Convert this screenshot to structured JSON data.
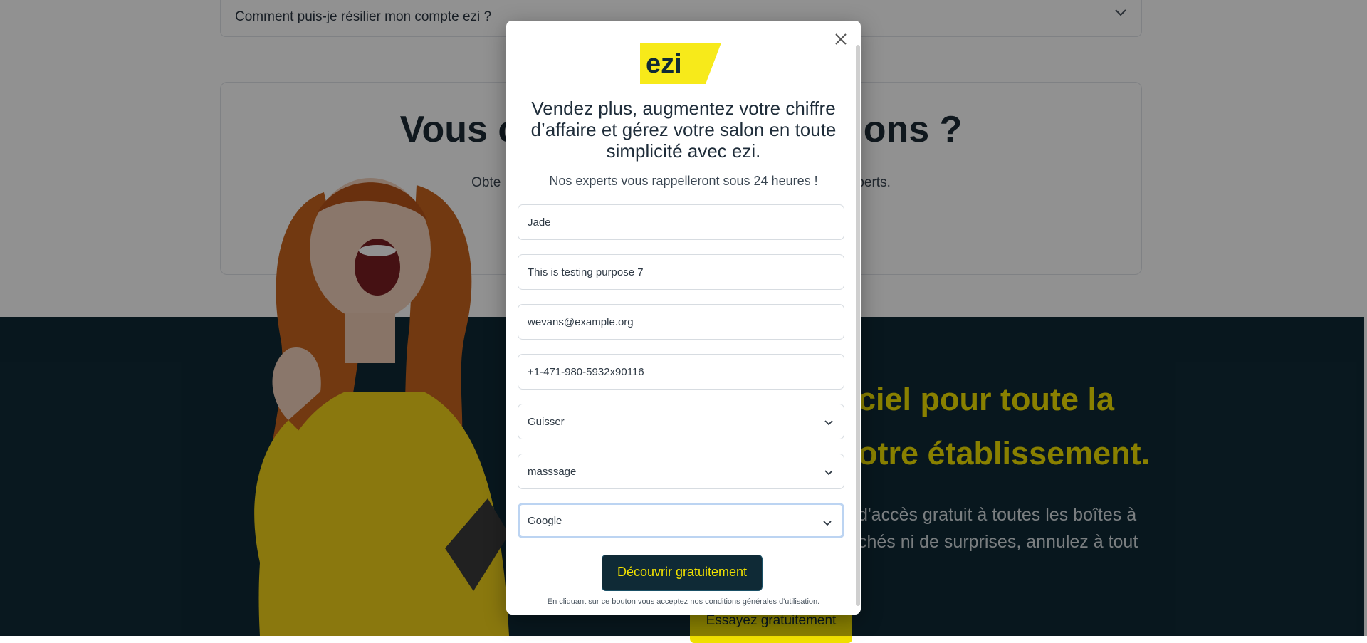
{
  "background": {
    "faq_question": "Comment puis-je résilier mon compte ezi ?",
    "contact_title_left": "Vous c",
    "contact_title_right": "ions ?",
    "contact_sub_left": "Obte",
    "contact_sub_right": "perts.",
    "band_title_line1": "ciel pour toute la",
    "band_title_line2": "otre établissement.",
    "band_text_line1": "d'accès gratuit à toutes les boîtes à",
    "band_text_line2": "chés ni de surprises, annulez à tout",
    "band_cta": "Essayez gratuitement"
  },
  "modal": {
    "logo_text": "ezi",
    "headline": "Vendez plus, augmentez votre chiffre d’affaire et gérez votre salon en toute simplicité avec ezi.",
    "subline": "Nos experts vous rappelleront sous 24 heures !",
    "fields": {
      "first_name": "Jade",
      "last_name": "This is testing purpose 7",
      "email": "wevans@example.org",
      "phone": "+1-471-980-5932x90116",
      "country": "Guisser",
      "activity": "masssage",
      "source": "Google"
    },
    "submit_label": "Découvrir gratuitement",
    "legal": "En cliquant sur ce bouton vous acceptez nos conditions générales d'utilisation."
  },
  "colors": {
    "brand_yellow": "#f1e100",
    "brand_dark": "#0f2a36",
    "focus_ring": "#bcd4f2"
  },
  "icons": [
    "close-icon",
    "chevron-down-icon",
    "ezi-logo"
  ]
}
